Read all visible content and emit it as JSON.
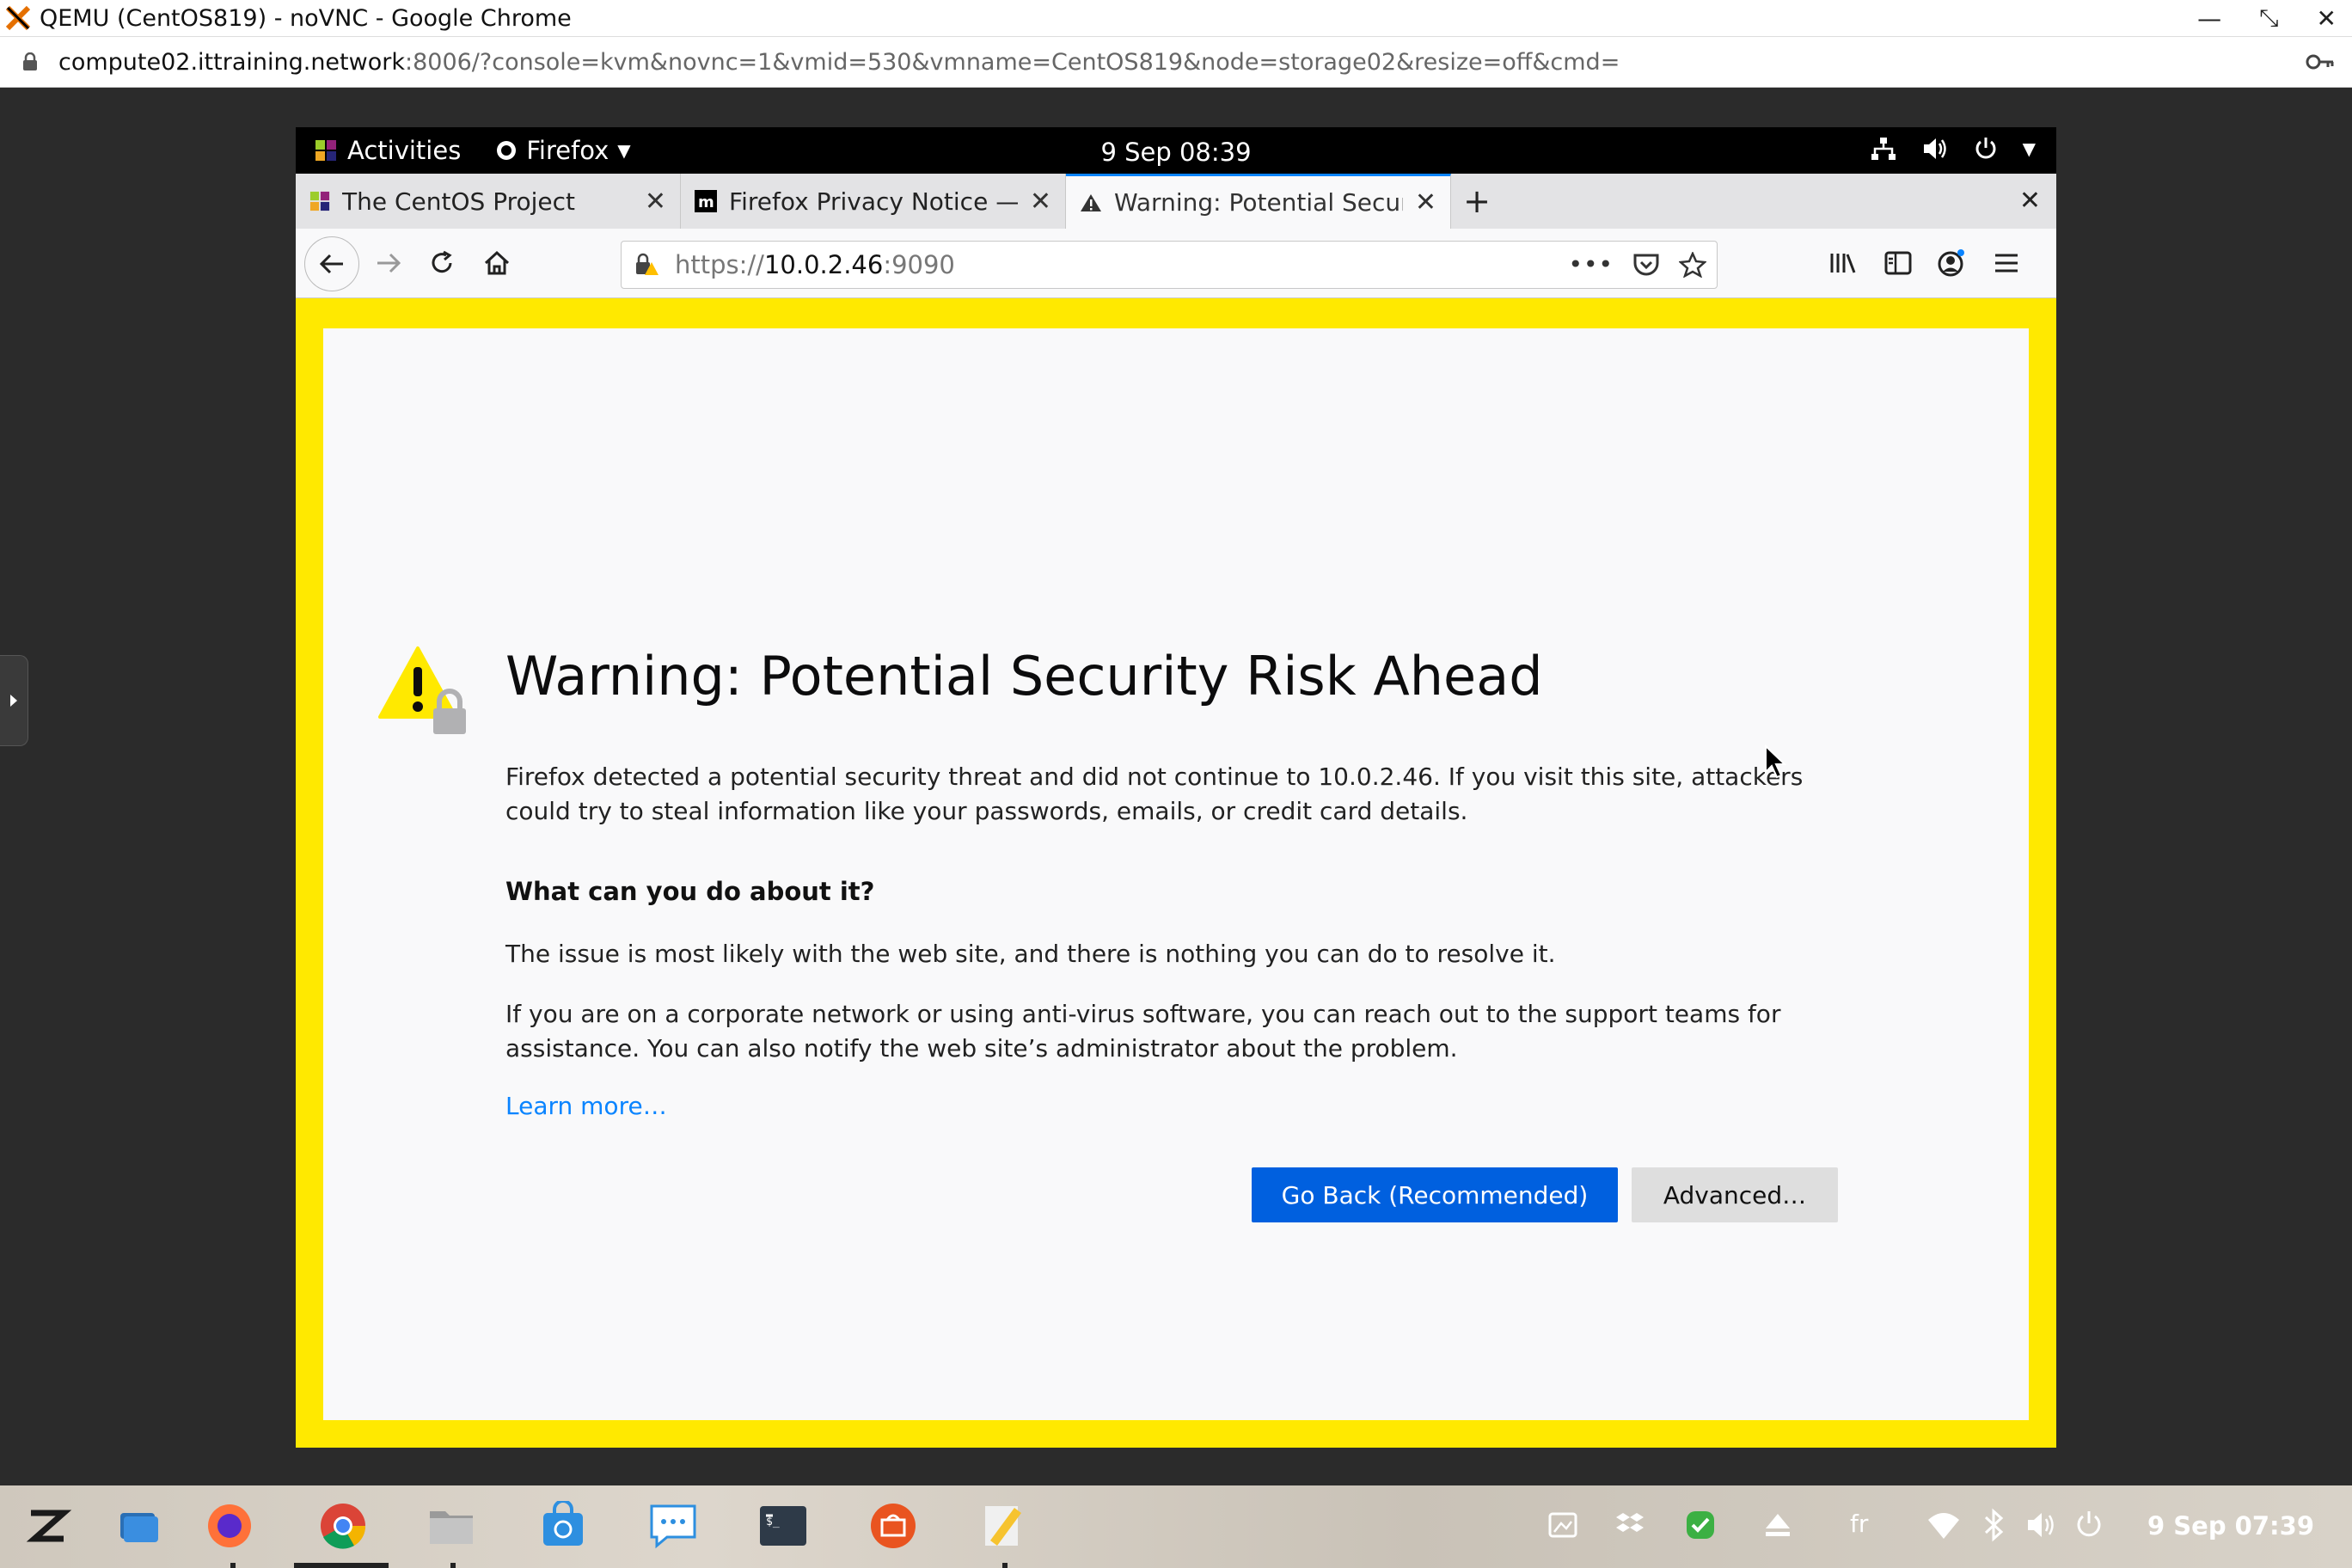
{
  "chrome": {
    "title": "QEMU (CentOS819) - noVNC - Google Chrome",
    "url_host": "compute02.ittraining.network",
    "url_rest": ":8006/?console=kvm&novnc=1&vmid=530&vmname=CentOS819&node=storage02&resize=off&cmd="
  },
  "gnome": {
    "activities": "Activities",
    "app_menu": "Firefox",
    "clock": "9 Sep  08:39"
  },
  "firefox": {
    "tabs": [
      {
        "label": "The CentOS Project",
        "active": false
      },
      {
        "label": "Firefox Privacy Notice —",
        "active": false
      },
      {
        "label": "Warning: Potential Securi",
        "active": true
      }
    ],
    "url_prefix": "https://",
    "url_host": "10.0.2.46",
    "url_port": ":9090"
  },
  "error_page": {
    "title": "Warning: Potential Security Risk Ahead",
    "p1": "Firefox detected a potential security threat and did not continue to 10.0.2.46. If you visit this site, attackers could try to steal information like your passwords, emails, or credit card details.",
    "heading": "What can you do about it?",
    "p2": "The issue is most likely with the web site, and there is nothing you can do to resolve it.",
    "p3": "If you are on a corporate network or using anti-virus software, you can reach out to the support teams for assistance. You can also notify the web site’s administrator about the problem.",
    "learn_more": "Learn more…",
    "go_back": "Go Back (Recommended)",
    "advanced": "Advanced…"
  },
  "taskbar": {
    "keyboard_layout": "fr",
    "clock": "9 Sep  07:39"
  },
  "colors": {
    "warning_border": "#ffe900",
    "primary_button": "#0060df",
    "link": "#0a84ff"
  }
}
